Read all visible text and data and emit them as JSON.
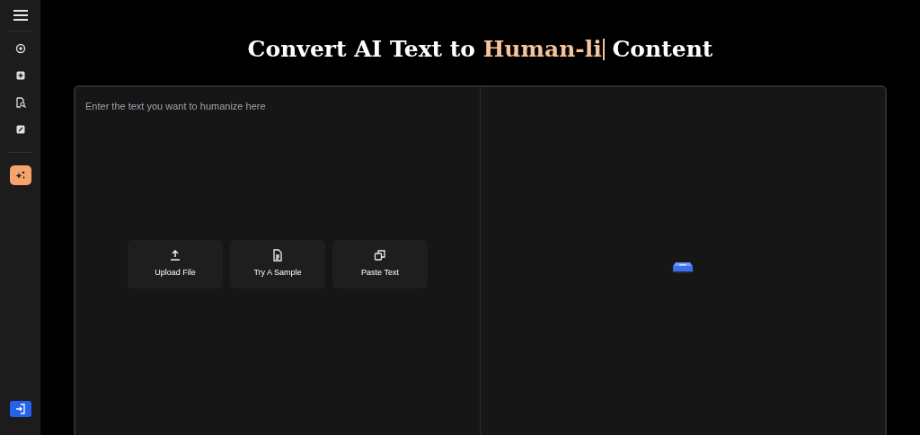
{
  "sidebar": {
    "items": [
      {
        "kind": "scan",
        "selected": false
      },
      {
        "kind": "plus",
        "selected": false
      },
      {
        "kind": "doc-search",
        "selected": false
      },
      {
        "kind": "edit",
        "selected": false
      },
      {
        "kind": "sparkle",
        "selected": true
      }
    ]
  },
  "title": [
    {
      "text": "Convert AI Text to ",
      "kind": "plain"
    },
    {
      "text": "Human-li",
      "kind": "accent"
    },
    {
      "text": " Content",
      "kind": "plain"
    }
  ],
  "editor": {
    "placeholder": "Enter the text you want to humanize here",
    "actions": [
      {
        "kind": "upload",
        "label": "Upload File"
      },
      {
        "kind": "sample",
        "label": "Try A Sample"
      },
      {
        "kind": "paste",
        "label": "Paste Text"
      }
    ]
  }
}
